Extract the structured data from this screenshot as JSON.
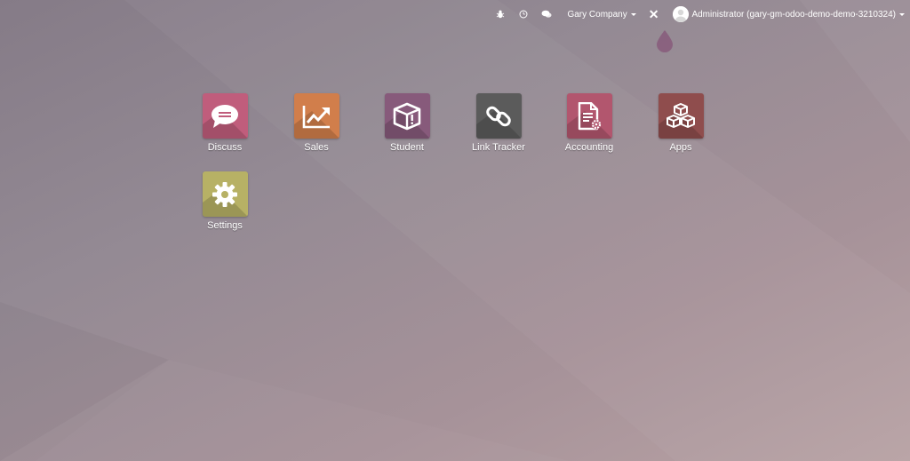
{
  "topbar": {
    "company": "Gary Company",
    "user": "Administrator (gary-gm-odoo-demo-demo-3210324)"
  },
  "icons": {
    "debug": "bug-icon",
    "activity": "clock-icon",
    "messages": "chat-icon",
    "close": "close-icon",
    "logo": "odoo-drop-icon"
  },
  "apps": [
    {
      "label": "Discuss",
      "icon": "chat-bubble-icon",
      "color": "#c05d7c"
    },
    {
      "label": "Sales",
      "icon": "trend-chart-icon",
      "color": "#d17e4b"
    },
    {
      "label": "Student",
      "icon": "box-icon",
      "color": "#875a7b"
    },
    {
      "label": "Link Tracker",
      "icon": "link-icon",
      "color": "#5b5b5b"
    },
    {
      "label": "Accounting",
      "icon": "document-gear-icon",
      "color": "#b2566e"
    },
    {
      "label": "Apps",
      "icon": "cubes-icon",
      "color": "#8f4d4d"
    },
    {
      "label": "Settings",
      "icon": "gear-icon",
      "color": "#b7b165"
    }
  ]
}
